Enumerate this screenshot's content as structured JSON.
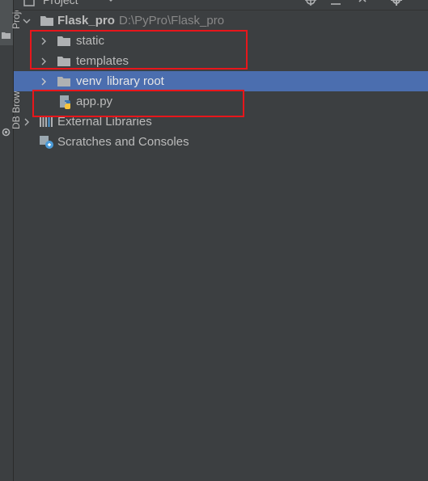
{
  "sidebar": {
    "project_tab": "Proje",
    "db_tab": "DB Browser"
  },
  "header": {
    "title": "Project"
  },
  "tree": {
    "root": {
      "name": "Flask_pro",
      "path": "D:\\PyPro\\Flask_pro"
    },
    "items": [
      {
        "label": "static"
      },
      {
        "label": "templates"
      },
      {
        "label": "venv",
        "suffix": "library root"
      },
      {
        "label": "app.py"
      },
      {
        "label": "External Libraries"
      },
      {
        "label": "Scratches and Consoles"
      }
    ]
  },
  "colors": {
    "background": "#3C3F41",
    "selection": "#4B6EAF",
    "annotation": "#E8161B",
    "folder": "#AFB1B3"
  }
}
